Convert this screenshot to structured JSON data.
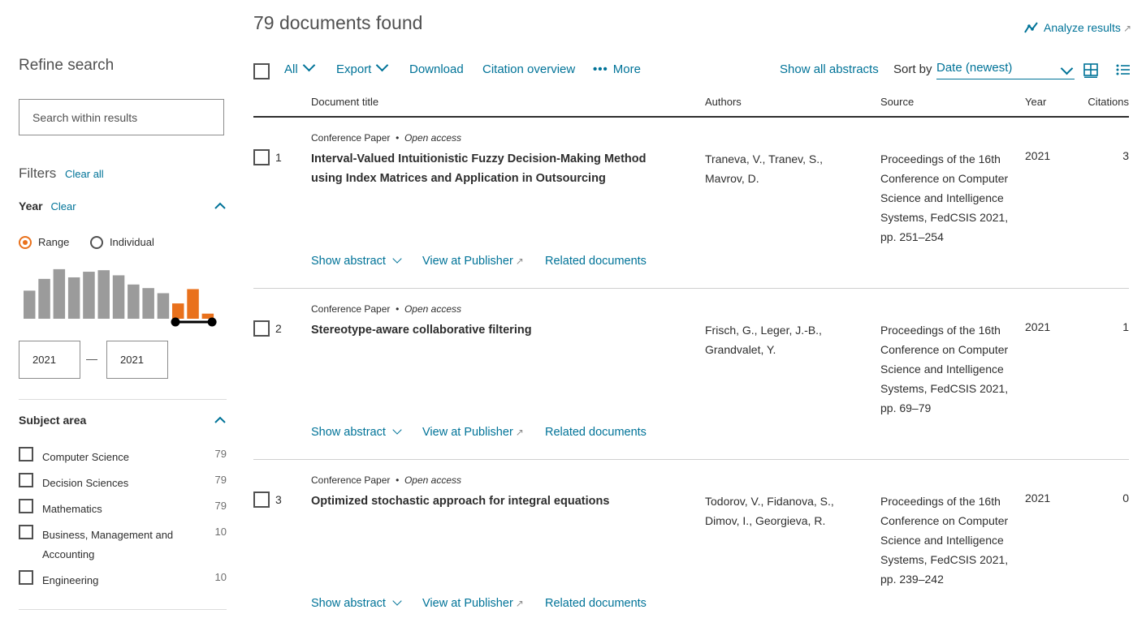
{
  "header": {
    "found": "79 documents found",
    "analyze_label": "Analyze results",
    "analyze_icon": "trend-line-icon",
    "external_glyph": "↗"
  },
  "sidebar": {
    "refine_title": "Refine search",
    "search_placeholder": "Search within results",
    "filters_label": "Filters",
    "clear_all": "Clear all",
    "year": {
      "label": "Year",
      "clear": "Clear",
      "range_label": "Range",
      "individual_label": "Individual",
      "selected_mode": "Range",
      "from": "2021",
      "to": "2021",
      "dash": "—",
      "histogram_heights": [
        0.55,
        0.78,
        0.97,
        0.81,
        0.92,
        0.95,
        0.85,
        0.67,
        0.6,
        0.5,
        0.3,
        0.58,
        0.1
      ]
    },
    "subject": {
      "label": "Subject area",
      "items": [
        {
          "name": "Computer Science",
          "count": "79"
        },
        {
          "name": "Decision Sciences",
          "count": "79"
        },
        {
          "name": "Mathematics",
          "count": "79"
        },
        {
          "name": "Business, Management and Accounting",
          "count": "10"
        },
        {
          "name": "Engineering",
          "count": "10"
        }
      ]
    }
  },
  "toolbar": {
    "all": "All",
    "export": "Export",
    "download": "Download",
    "citation": "Citation overview",
    "more": "More",
    "more_icon": "•••",
    "show_abstracts": "Show all abstracts",
    "sort_by": "Sort by",
    "sort_value": "Date (newest)"
  },
  "columns": {
    "title": "Document title",
    "authors": "Authors",
    "source": "Source",
    "year": "Year",
    "citations": "Citations"
  },
  "results": [
    {
      "num": "1",
      "type": "Conference Paper",
      "access": "Open access",
      "title": "Interval-Valued Intuitionistic Fuzzy Decision-Making Method using Index Matrices and Application in Outsourcing",
      "authors": "Traneva, V., Tranev, S., Mavrov, D.",
      "source": "Proceedings of the 16th Conference on Computer Science and Intelligence Systems, FedCSIS 2021, pp. 251–254",
      "year": "2021",
      "citations": "3"
    },
    {
      "num": "2",
      "type": "Conference Paper",
      "access": "Open access",
      "title": "Stereotype-aware collaborative filtering",
      "authors": "Frisch, G., Leger, J.-B., Grandvalet, Y.",
      "source": "Proceedings of the 16th Conference on Computer Science and Intelligence Systems, FedCSIS 2021, pp. 69–79",
      "year": "2021",
      "citations": "1"
    },
    {
      "num": "3",
      "type": "Conference Paper",
      "access": "Open access",
      "title": "Optimized stochastic approach for integral equations",
      "authors": "Todorov, V., Fidanova, S., Dimov, I., Georgieva, R.",
      "source": "Proceedings of the 16th Conference on Computer Science and Intelligence Systems, FedCSIS 2021, pp. 239–242",
      "year": "2021",
      "citations": "0"
    }
  ],
  "actions": {
    "show_abstract": "Show abstract",
    "view_publisher": "View at Publisher",
    "related": "Related documents"
  },
  "colors": {
    "link": "#007398",
    "accent": "#e9711c",
    "histogram_bar": "#9b9b9b"
  }
}
